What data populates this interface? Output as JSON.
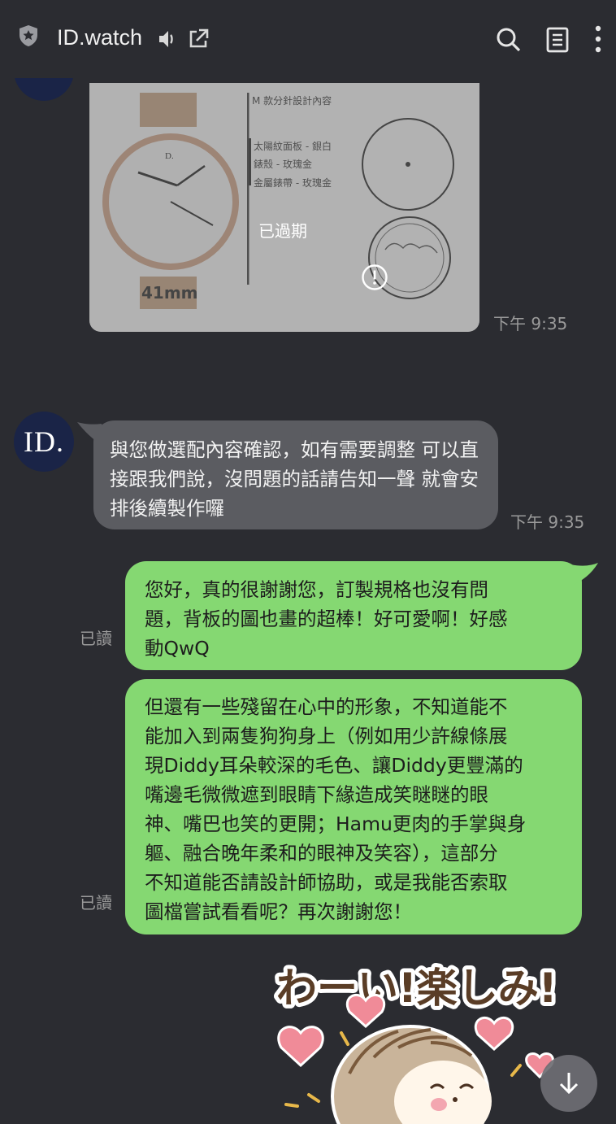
{
  "header": {
    "title": "ID.watch",
    "icons": [
      "shield-icon",
      "mute-icon",
      "external-link-icon",
      "search-icon",
      "notes-icon",
      "more-icon"
    ]
  },
  "image_message": {
    "status_text": "已過期",
    "time": "下午 9:35",
    "watch_text": {
      "size_label": "41mm",
      "spec_title": "M 款分針設計內容",
      "spec_lines": [
        "太陽紋面板 - 銀白",
        "錶殼 - 玫瑰金",
        "金屬錶帶 - 玫瑰金"
      ]
    }
  },
  "received_message": {
    "avatar_text": "ID.",
    "text": "與您做選配內容確認，如有需要調整 可以直接跟我們說，沒問題的話請告知一聲 就會安排後續製作囉",
    "time": "下午 9:35"
  },
  "sent_messages": [
    {
      "read_label": "已讀",
      "lines": [
        "您好，真的很謝謝您，訂製規格也沒有問",
        "題，背板的圖也畫的超棒！好可愛啊！好感",
        "動QwQ"
      ]
    },
    {
      "read_label": "已讀",
      "lines": [
        "但還有一些殘留在心中的形象，不知道能不",
        "能加入到兩隻狗狗身上（例如用少許線條展",
        "現Diddy耳朵較深的毛色、讓Diddy更豐滿的",
        "嘴邊毛微微遮到眼睛下緣造成笑瞇瞇的眼",
        "神、嘴巴也笑的更開；Hamu更肉的手掌與身",
        "軀、融合晚年柔和的眼神及笑容），這部分",
        "不知道能否請設計師協助，或是我能否索取",
        "圖檔嘗試看看呢？再次謝謝您！"
      ]
    }
  ],
  "sticker": {
    "text": "わーい!楽しみ!"
  },
  "colors": {
    "background": "#2b2c31",
    "sent_bubble": "#85d872",
    "received_bubble": "#5b5c61",
    "avatar": "#1a2447"
  }
}
